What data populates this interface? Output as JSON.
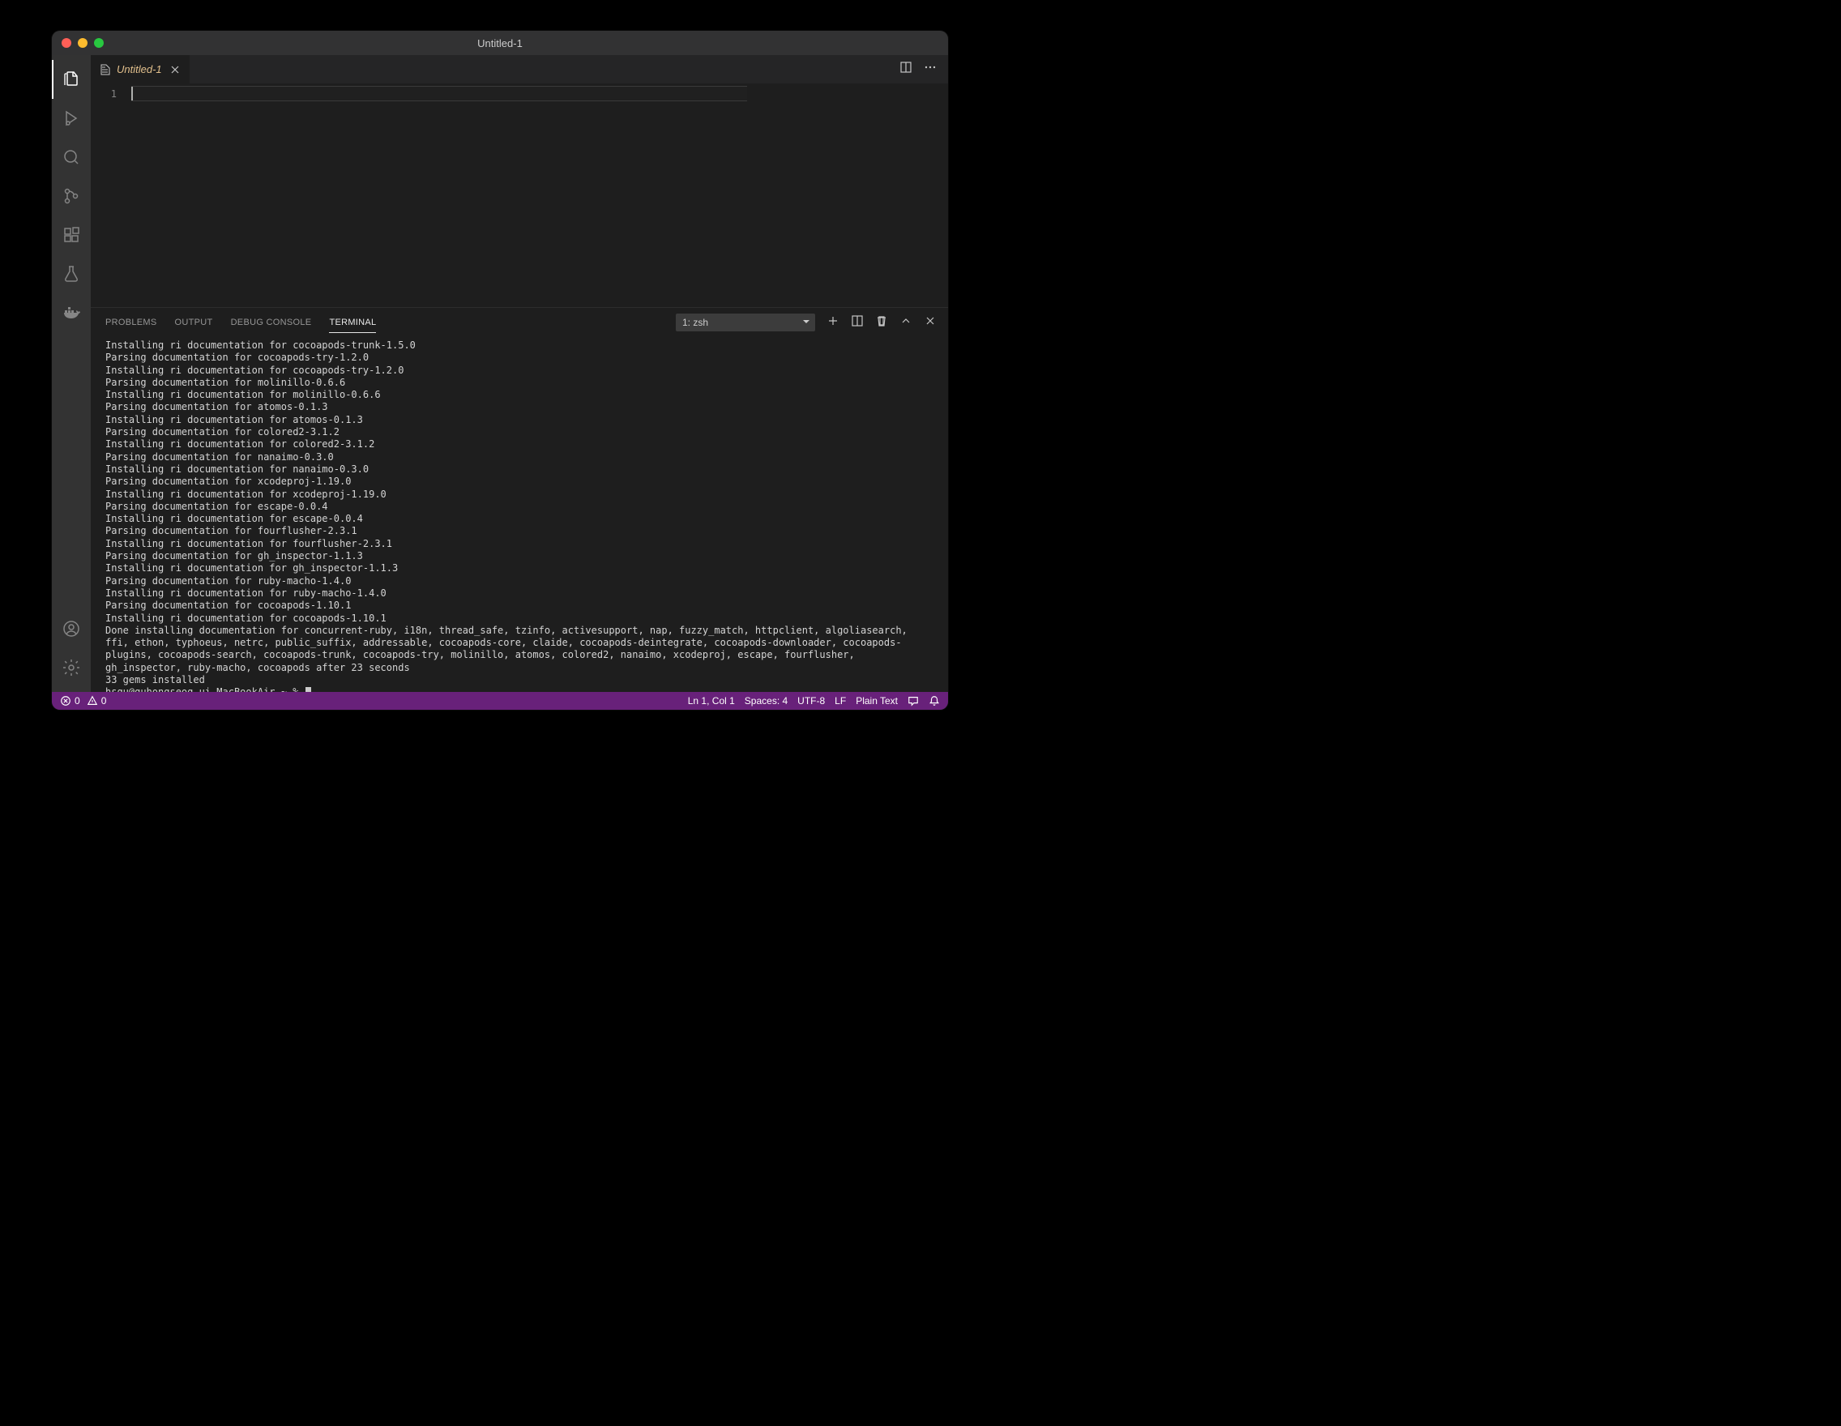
{
  "window": {
    "title": "Untitled-1"
  },
  "tab": {
    "label": "Untitled-1"
  },
  "editor": {
    "lineNumber": "1"
  },
  "panel": {
    "tabs": {
      "problems": "PROBLEMS",
      "output": "OUTPUT",
      "debugConsole": "DEBUG CONSOLE",
      "terminal": "TERMINAL"
    },
    "shell": "1: zsh"
  },
  "terminalLines": [
    "Installing ri documentation for cocoapods-trunk-1.5.0",
    "Parsing documentation for cocoapods-try-1.2.0",
    "Installing ri documentation for cocoapods-try-1.2.0",
    "Parsing documentation for molinillo-0.6.6",
    "Installing ri documentation for molinillo-0.6.6",
    "Parsing documentation for atomos-0.1.3",
    "Installing ri documentation for atomos-0.1.3",
    "Parsing documentation for colored2-3.1.2",
    "Installing ri documentation for colored2-3.1.2",
    "Parsing documentation for nanaimo-0.3.0",
    "Installing ri documentation for nanaimo-0.3.0",
    "Parsing documentation for xcodeproj-1.19.0",
    "Installing ri documentation for xcodeproj-1.19.0",
    "Parsing documentation for escape-0.0.4",
    "Installing ri documentation for escape-0.0.4",
    "Parsing documentation for fourflusher-2.3.1",
    "Installing ri documentation for fourflusher-2.3.1",
    "Parsing documentation for gh_inspector-1.1.3",
    "Installing ri documentation for gh_inspector-1.1.3",
    "Parsing documentation for ruby-macho-1.4.0",
    "Installing ri documentation for ruby-macho-1.4.0",
    "Parsing documentation for cocoapods-1.10.1",
    "Installing ri documentation for cocoapods-1.10.1",
    "Done installing documentation for concurrent-ruby, i18n, thread_safe, tzinfo, activesupport, nap, fuzzy_match, httpclient, algoliasearch, ffi, ethon, typhoeus, netrc, public_suffix, addressable, cocoapods-core, claide, cocoapods-deintegrate, cocoapods-downloader, cocoapods-plugins, cocoapods-search, cocoapods-trunk, cocoapods-try, molinillo, atomos, colored2, nanaimo, xcodeproj, escape, fourflusher, gh_inspector, ruby-macho, cocoapods after 23 seconds",
    "33 gems installed"
  ],
  "prompt": "hsgu@guhongseog-ui-MacBookAir ~ % ",
  "status": {
    "errors": "0",
    "warnings": "0",
    "lnCol": "Ln 1, Col 1",
    "spaces": "Spaces: 4",
    "encoding": "UTF-8",
    "eol": "LF",
    "language": "Plain Text"
  }
}
